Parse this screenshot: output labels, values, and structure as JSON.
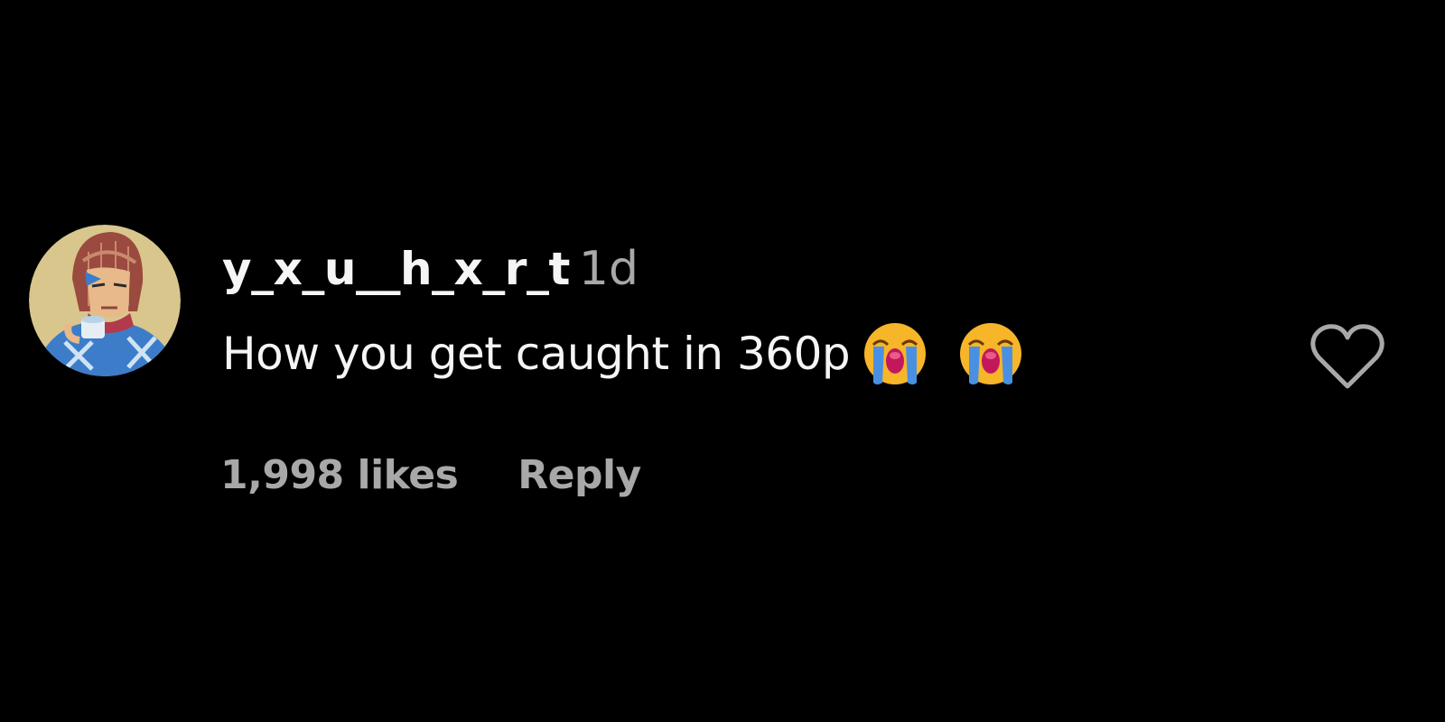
{
  "comment": {
    "username": "y_x_u__h_x_r_t",
    "time_ago": "1d",
    "text": "How you get caught in 360p",
    "emojis": [
      "loudly-crying-face-icon",
      "loudly-crying-face-icon"
    ],
    "likes": "1,998 likes",
    "reply_label": "Reply"
  },
  "colors": {
    "background": "#000000",
    "primary_text": "#f5f5f5",
    "secondary_text": "#a8a8a8",
    "emoji_face": "#f7b529",
    "emoji_tears": "#4a90e2",
    "emoji_mouth": "#c2185b"
  },
  "icons": {
    "avatar": "avatar-image",
    "like": "heart-outline-icon"
  }
}
